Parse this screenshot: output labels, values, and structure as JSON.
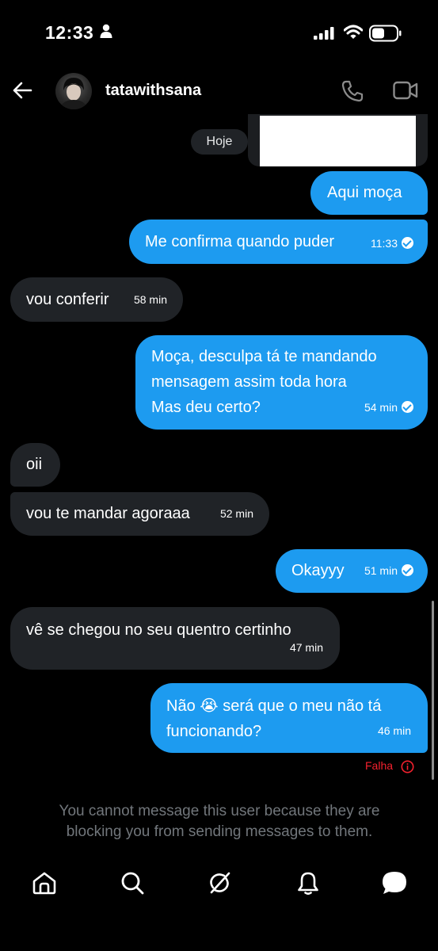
{
  "status_bar": {
    "time": "12:33"
  },
  "header": {
    "username": "tatawithsana"
  },
  "chat": {
    "date_chip": "Hoje",
    "messages": [
      {
        "dir": "out",
        "text": "Aqui moça",
        "time": ""
      },
      {
        "dir": "out",
        "text": "Me confirma quando puder",
        "time": "11:33"
      },
      {
        "dir": "in",
        "text": "vou conferir",
        "time": "58 min"
      },
      {
        "dir": "out",
        "line1": "Moça, desculpa tá te mandando",
        "line2": "mensagem assim toda hora",
        "line3": "Mas deu certo?",
        "time": "54 min"
      },
      {
        "dir": "in",
        "text": "oii",
        "time": ""
      },
      {
        "dir": "in",
        "text": "vou te mandar agoraaa",
        "time": "52 min"
      },
      {
        "dir": "out",
        "text": "Okayyy",
        "time": "51 min"
      },
      {
        "dir": "in",
        "text": "vê se chegou no seu quentro certinho",
        "time": "47 min"
      },
      {
        "dir": "out",
        "line1a": "Não",
        "emoji": "😭",
        "line1b": "será que o meu não tá",
        "line2": "funcionando?",
        "time": "46 min"
      }
    ],
    "fail_label": "Falha",
    "blocked_notice": "You cannot message this user because they are blocking you from sending messages to them."
  },
  "colors": {
    "accent": "#1d9bf0",
    "incoming_bubble": "#202327",
    "error": "#f4212e",
    "muted": "#71767b"
  },
  "icons": [
    "back-arrow-icon",
    "phone-icon",
    "video-icon",
    "home-icon",
    "search-icon",
    "grok-icon",
    "notifications-icon",
    "messages-icon"
  ]
}
